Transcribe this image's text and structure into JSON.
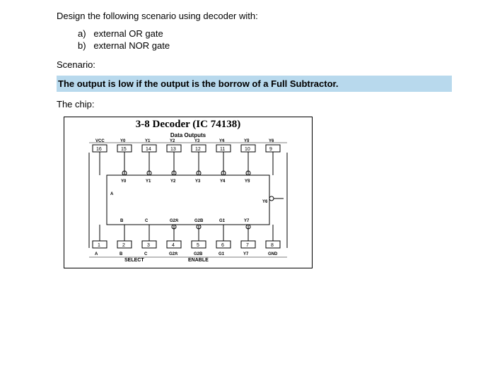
{
  "question": "Design the following scenario using decoder with:",
  "options": [
    {
      "letter": "a)",
      "text": "external OR gate"
    },
    {
      "letter": "b)",
      "text": "external NOR gate"
    }
  ],
  "scenarioLabel": "Scenario:",
  "scenarioText": "The output is low if the output is the borrow of a Full Subtractor.",
  "chipLabel": "The chip:",
  "diagram": {
    "title": "3-8 Decoder (IC 74138)",
    "subtitle": "Data Outputs",
    "topPinLabels": [
      "VCC",
      "Y0",
      "Y1",
      "Y2",
      "Y3",
      "Y4",
      "Y5",
      "Y6"
    ],
    "topPinNumbers": [
      "16",
      "15",
      "14",
      "13",
      "12",
      "11",
      "10",
      "9"
    ],
    "innerTopLabels": [
      "Y0",
      "Y1",
      "Y2",
      "Y3",
      "Y4",
      "Y5"
    ],
    "innerSideLabels": {
      "leftA": "A",
      "rightY6": "Y6"
    },
    "innerBottomLabels": [
      "B",
      "C",
      "G2A",
      "G2B",
      "G1",
      "Y7"
    ],
    "botPinNumbers": [
      "1",
      "2",
      "3",
      "4",
      "5",
      "6",
      "7",
      "8"
    ],
    "botPinLabels": [
      "A",
      "B",
      "C",
      "G2A",
      "G2B",
      "G1",
      "Y7",
      "GND"
    ],
    "selectLabel": "SELECT",
    "enableLabel": "ENABLE"
  }
}
